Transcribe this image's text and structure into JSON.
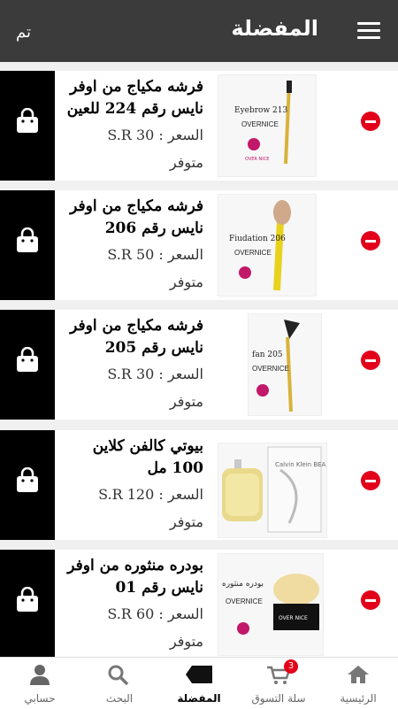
{
  "header": {
    "title": "المفضلة",
    "done_label": "تم"
  },
  "products": [
    {
      "name": "فرشه مكياج من اوفر نايس رقم 224 للعين",
      "price": "السعر : 30 S.R",
      "availability": "متوفر",
      "image_label": "Eyebrow 213",
      "brand": "OVERNICE"
    },
    {
      "name": "فرشه مكياج من اوفر نايس رقم 206",
      "price": "السعر : 50 S.R",
      "availability": "متوفر",
      "image_label": "Fiudation 206",
      "brand": "OVERNICE"
    },
    {
      "name": "فرشه مكياج من اوفر نايس رقم 205",
      "price": "السعر : 30 S.R",
      "availability": "متوفر",
      "image_label": "fan 205",
      "brand": "OVERNICE"
    },
    {
      "name": "بيوتي كالفن كلاين 100 مل",
      "price": "السعر : 120 S.R",
      "availability": "متوفر",
      "image_label": "Calvin Klein BEAUTY",
      "brand": ""
    },
    {
      "name": "بودره منثوره من اوفر نايس رقم 01",
      "price": "السعر : 60 S.R",
      "availability": "متوفر",
      "image_label": "بودره منثوره",
      "brand": "OVERNICE"
    }
  ],
  "bottom_nav": {
    "home": "الرئيسية",
    "cart": "سلة التسوق",
    "cart_count": "3",
    "favorites": "المفضلة",
    "search": "البحث",
    "account": "حسابي"
  }
}
